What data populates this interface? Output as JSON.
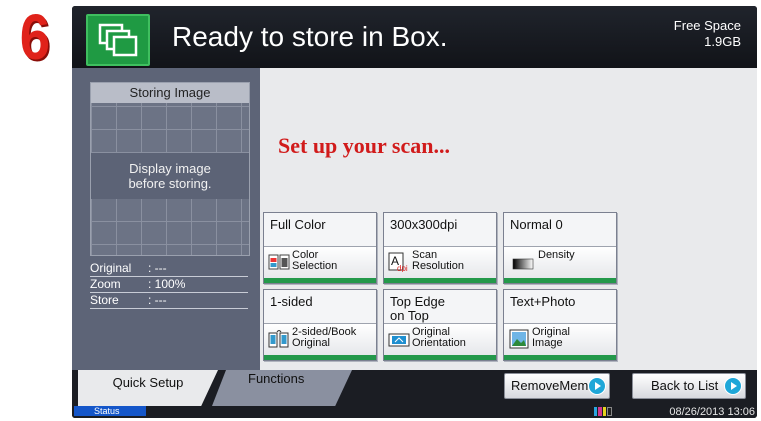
{
  "step_number": "6",
  "header": {
    "title": "Ready to store in Box.",
    "free_space_label": "Free Space",
    "free_space_value": "1.9GB"
  },
  "preview": {
    "heading": "Storing Image",
    "message_line1": "Display image",
    "message_line2": "before storing.",
    "info": [
      {
        "key": "Original",
        "value": ": ---"
      },
      {
        "key": "Zoom",
        "value": ": 100%"
      },
      {
        "key": "Store",
        "value": ": ---"
      }
    ]
  },
  "headline": "Set up your scan...",
  "tiles": [
    {
      "value": "Full Color",
      "label_line1": "Color",
      "label_line2": "Selection",
      "icon": "color-selection-icon"
    },
    {
      "value": "300x300dpi",
      "label_line1": "Scan",
      "label_line2": "Resolution",
      "icon": "resolution-icon"
    },
    {
      "value": "Normal 0",
      "label_line1": "Density",
      "label_line2": "",
      "icon": "density-icon"
    },
    {
      "value": "1-sided",
      "label_line1": "2-sided/Book",
      "label_line2": "Original",
      "icon": "duplex-icon"
    },
    {
      "value_line1": "Top Edge",
      "value_line2": "on Top",
      "label_line1": "Original",
      "label_line2": "Orientation",
      "icon": "orientation-icon"
    },
    {
      "value": "Text+Photo",
      "label_line1": "Original",
      "label_line2": "Image",
      "icon": "original-image-icon"
    }
  ],
  "tabs": {
    "quick_setup": "Quick Setup",
    "functions": "Functions"
  },
  "buttons": {
    "remove_memory": "RemoveMemo",
    "back_to_list": "Back to List"
  },
  "status_bar": {
    "status": "Status",
    "datetime": "08/26/2013 13:06"
  },
  "colors": {
    "accent_green": "#23984a",
    "headline_red": "#d11b1b",
    "status_blue": "#1456c9"
  }
}
